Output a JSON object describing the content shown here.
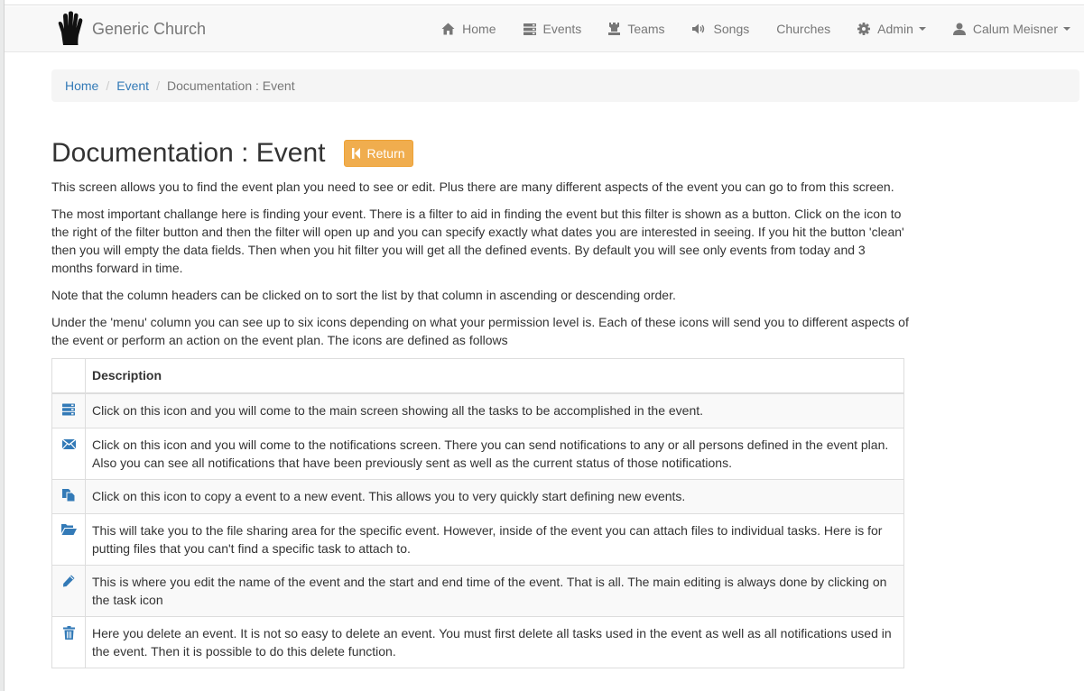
{
  "brand": {
    "name": "Generic Church",
    "logo_icon": "hand-icon"
  },
  "nav": {
    "items": [
      {
        "label": "Home",
        "icon": "home-icon"
      },
      {
        "label": "Events",
        "icon": "tasks-icon"
      },
      {
        "label": "Teams",
        "icon": "tower-icon"
      },
      {
        "label": "Songs",
        "icon": "volume-icon"
      },
      {
        "label": "Churches",
        "icon": ""
      },
      {
        "label": "Admin",
        "icon": "gear-icon"
      },
      {
        "label": "Calum Meisner",
        "icon": "user-icon"
      }
    ]
  },
  "breadcrumb": {
    "home": "Home",
    "sep": "/",
    "event": "Event",
    "current": "Documentation : Event"
  },
  "page": {
    "title": "Documentation : Event",
    "return_label": "Return",
    "paragraphs": [
      "This screen allows you to find the event plan you need to see or edit. Plus there are many different aspects of the event you can go to from this screen.",
      "The most important challange here is finding your event. There is a filter to aid in finding the event but this filter is shown as a button. Click on the icon to the right of the filter button and then the filter will open up and you can specify exactly what dates you are interested in seeing. If you hit the button 'clean' then you will empty the data fields. Then when you hit filter you will get all the defined events. By default you will see only events from today and 3 months forward in time.",
      "Note that the column headers can be clicked on to sort the list by that column in ascending or descending order.",
      "Under the 'menu' column you can see up to six icons depending on what your permission level is. Each of these icons will send you to different aspects of the event or perform an action on the event plan. The icons are defined as follows"
    ]
  },
  "table": {
    "header_description": "Description",
    "rows": [
      {
        "icon": "tasks-icon",
        "text": "Click on this icon and you will come to the main screen showing all the tasks to be accomplished in the event."
      },
      {
        "icon": "envelope-icon",
        "text": "Click on this icon and you will come to the notifications screen. There you can send notifications to any or all persons defined in the event plan. Also you can see all notifications that have been previously sent as well as the current status of those notifications."
      },
      {
        "icon": "copy-icon",
        "text": "Click on this icon to copy a event to a new event. This allows you to very quickly start defining new events."
      },
      {
        "icon": "folder-open-icon",
        "text": "This will take you to the file sharing area for the specific event. However, inside of the event you can attach files to individual tasks. Here is for putting files that you can't find a specific task to attach to."
      },
      {
        "icon": "pencil-icon",
        "text": "This is where you edit the name of the event and the start and end time of the event. That is all. The main editing is always done by clicking on the task icon"
      },
      {
        "icon": "trash-icon",
        "text": "Here you delete an event. It is not so easy to delete an event. You must first delete all tasks used in the event as well as all notifications used in the event. Then it is possible to do this delete function."
      }
    ]
  },
  "colors": {
    "link": "#337ab7",
    "return_button": "#f0ad4e",
    "navbar_bg": "#f8f8f8"
  }
}
